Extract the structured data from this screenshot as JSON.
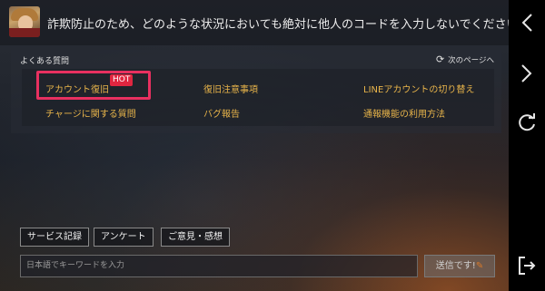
{
  "notice": {
    "text": "詐欺防止のため、どのような状況においても絶対に他人のコードを入力しないでください。"
  },
  "faq": {
    "title": "よくある質問",
    "next_page_label": "次のページへ",
    "hot_badge": "HOT",
    "items": [
      {
        "label": "アカウント復旧"
      },
      {
        "label": "復旧注意事項"
      },
      {
        "label": "LINEアカウントの切り替え"
      },
      {
        "label": "チャージに関する質問"
      },
      {
        "label": "バグ報告"
      },
      {
        "label": "通報機能の利用方法"
      }
    ]
  },
  "quick_buttons": [
    {
      "label": "サービス記録"
    },
    {
      "label": "アンケート"
    },
    {
      "label": "ご意見・感想"
    }
  ],
  "input": {
    "placeholder": "日本語でキーワードを入力"
  },
  "send_button": {
    "label": "送信です!"
  },
  "side_nav": {
    "icons": [
      "chevron-left-icon",
      "chevron-right-icon",
      "refresh-icon",
      "exit-icon"
    ]
  },
  "colors": {
    "faq_link": "#e8b44a",
    "hot_badge": "#e02640",
    "highlight_border": "#e83060"
  }
}
